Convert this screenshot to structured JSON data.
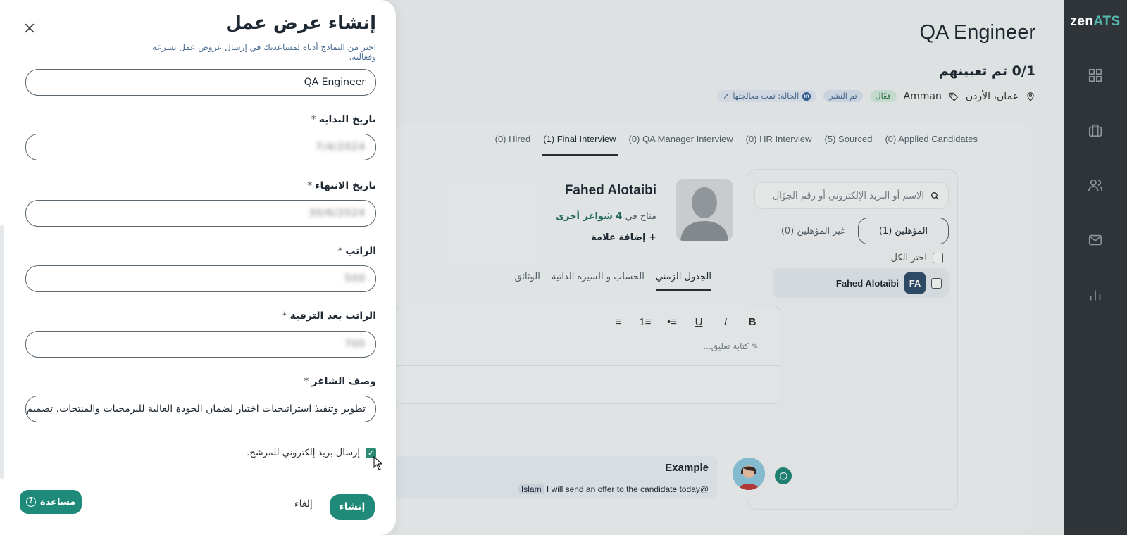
{
  "sidebar": {
    "logo_main": "zen",
    "logo_accent": "ATS",
    "icons": [
      "grid-icon",
      "briefcase-icon",
      "users-icon",
      "mail-icon",
      "chart-icon"
    ]
  },
  "job": {
    "title": "QA Engineer",
    "hired": "0/1 تم تعيينهم",
    "location": "عمان، الأردن",
    "city": "Amman",
    "status_active": "فعّال",
    "status_published": "تم النشر",
    "linkedin_status": "الحالة: تمت معالجتها"
  },
  "stages": [
    {
      "label": "(0) Applied Candidates"
    },
    {
      "label": "(5) Sourced"
    },
    {
      "label": "(0) HR Interview"
    },
    {
      "label": "(0) QA Manager Interview"
    },
    {
      "label": "(1) Final Interview"
    },
    {
      "label": "(0) Hired"
    }
  ],
  "candidates": {
    "search_placeholder": "الاسم أو البريد الإلكتروني أو رقم الجوّال",
    "qualified": "المؤهلين (1)",
    "unqualified": "غير المؤهلين (0)",
    "select_all": "اختر الكل",
    "list": [
      {
        "initials": "FA",
        "name": "Fahed Alotaibi"
      }
    ]
  },
  "profile": {
    "name": "Fahed Alotaibi",
    "available_prefix": "متاح في ",
    "available_count": "4 شواغر أخرى",
    "add_tag": "+ إضافة علامة",
    "tabs": [
      "الجدول الزمني",
      "الحساب و السيرة الذاتية",
      "الوثائق"
    ],
    "comment_placeholder": "كتابة تعليق...",
    "toolbar": [
      "B",
      "I",
      "U",
      "•≡",
      "1≡",
      "≡"
    ]
  },
  "activity": {
    "title": "Example",
    "mention": "Islam",
    "text": " I will send an offer to the candidate today@"
  },
  "modal": {
    "title": "إنشاء عرض عمل",
    "subtitle": "اختر من النماذج أدناه لمساعدتك في إرسال عروض عمل بسرعة وفعالية.",
    "job_title_value": "QA Engineer",
    "start_date_label": "تاريخ البداية",
    "start_date_value": "7/4/2024",
    "end_date_label": "تاريخ الانتهاء",
    "end_date_value": "30/6/2024",
    "salary_label": "الراتب",
    "salary_value": "500",
    "salary_after_label": "الراتب بعد الترقية",
    "salary_after_value": "700",
    "job_desc_label": "وصف الشاغر",
    "job_desc_value": "تطوير وتنفيذ استراتيجيات اختبار لضمان الجودة العالية للبرمجيات والمنتجات. تصميم",
    "required_mark": "*",
    "send_email_label": "إرسال بريد إلكتروني للمرشح.",
    "create_button": "إنشاء",
    "cancel_button": "إلغاء",
    "help_button": "مساعدة"
  },
  "colors": {
    "sidebar_bg": "#2e3438",
    "accent": "#1f8a7a",
    "link_blue": "#4a6b91"
  }
}
